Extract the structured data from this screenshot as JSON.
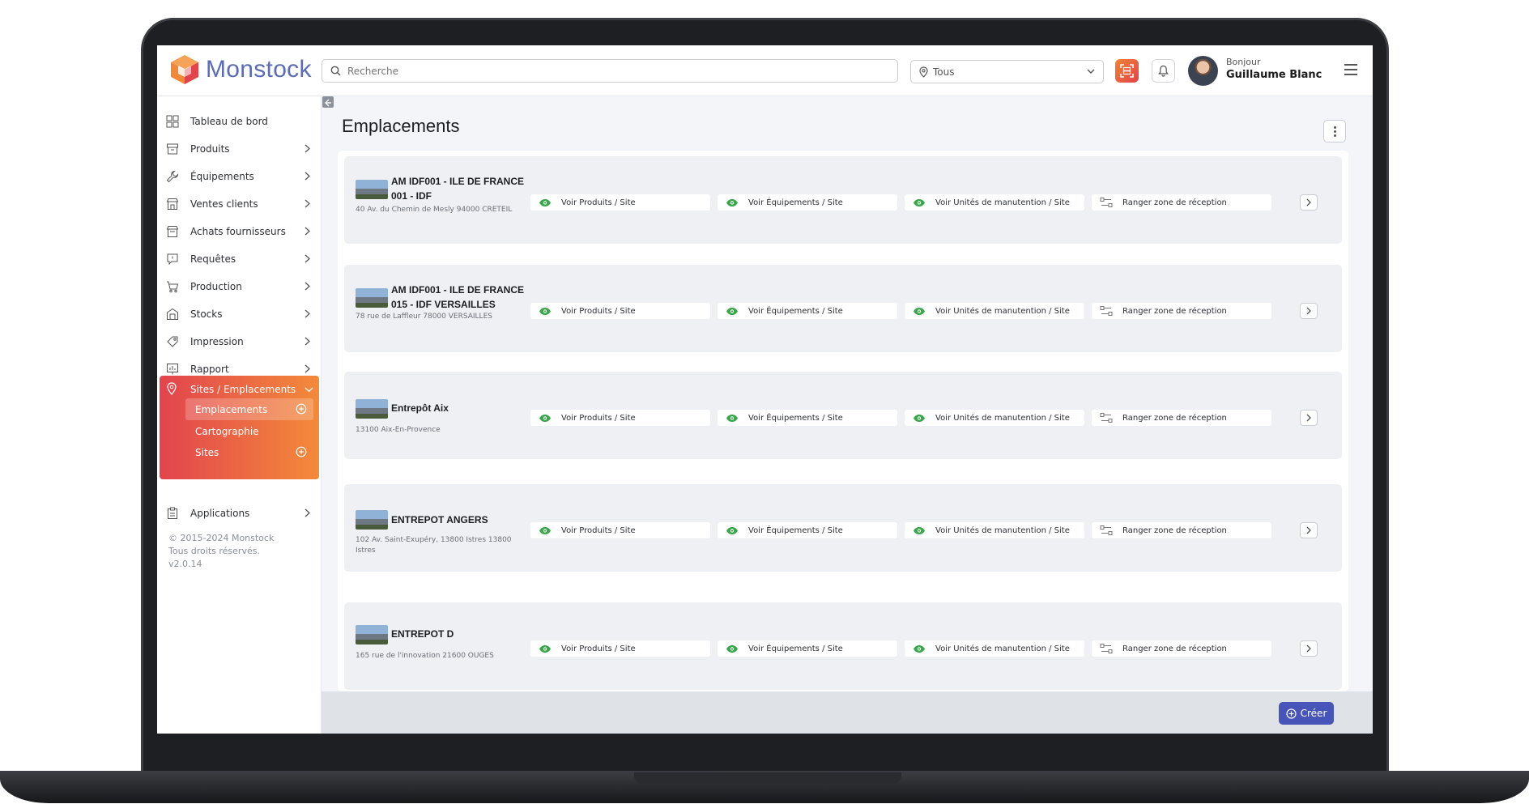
{
  "brand": {
    "name": "Monstock",
    "accent": "#5b6bb5",
    "gradient_start": "#e2444e",
    "gradient_end": "#f38a3a"
  },
  "topbar": {
    "search_placeholder": "Recherche",
    "site_filter": "Tous",
    "greeting": "Bonjour",
    "user_name": "Guillaume Blanc"
  },
  "sidebar": {
    "items": [
      {
        "label": "Tableau de bord",
        "icon": "dashboard-icon",
        "has_arrow": false
      },
      {
        "label": "Produits",
        "icon": "box-icon",
        "has_arrow": true
      },
      {
        "label": "Équipements",
        "icon": "wrench-icon",
        "has_arrow": true
      },
      {
        "label": "Ventes clients",
        "icon": "shop-icon",
        "has_arrow": true
      },
      {
        "label": "Achats fournisseurs",
        "icon": "store-icon",
        "has_arrow": true
      },
      {
        "label": "Requêtes",
        "icon": "message-icon",
        "has_arrow": true
      },
      {
        "label": "Production",
        "icon": "cart-icon",
        "has_arrow": true
      },
      {
        "label": "Stocks",
        "icon": "warehouse-icon",
        "has_arrow": true
      },
      {
        "label": "Impression",
        "icon": "tag-icon",
        "has_arrow": true
      },
      {
        "label": "Rapport",
        "icon": "report-icon",
        "has_arrow": true
      }
    ],
    "active_group": {
      "label": "Sites / Emplacements",
      "icon": "location-pin-icon",
      "children": [
        {
          "label": "Emplacements",
          "selected": true,
          "has_plus": true
        },
        {
          "label": "Cartographie",
          "selected": false,
          "has_plus": false
        },
        {
          "label": "Sites",
          "selected": false,
          "has_plus": true
        }
      ]
    },
    "after_items": [
      {
        "label": "Applications",
        "icon": "clipboard-icon",
        "has_arrow": true
      }
    ],
    "copyright_lines": [
      "© 2015-2024 Monstock",
      "Tous droits réservés.",
      "v2.0.14"
    ]
  },
  "main": {
    "title": "Emplacements",
    "actions": {
      "view_products": "Voir Produits / Site",
      "view_equipment": "Voir Équipements / Site",
      "view_units": "Voir Unités de manutention / Site",
      "store_reception": "Ranger zone de réception"
    },
    "locations": [
      {
        "name": "AM IDF001 - ILE DE FRANCE 001 - IDF",
        "address": "40 Av. du Chemin de Mesly 94000 CRETEIL"
      },
      {
        "name": "AM IDF001 - ILE DE FRANCE 015 - IDF VERSAILLES",
        "address": "78 rue de Laffleur 78000 VERSAILLES"
      },
      {
        "name": "Entrepôt Aix",
        "address": "13100 Aix-En-Provence"
      },
      {
        "name": "ENTREPOT ANGERS",
        "address": "102 Av. Saint-Exupéry, 13800 Istres 13800 Istres"
      },
      {
        "name": "ENTREPOT D",
        "address": "165 rue de l'innovation 21600 OUGES"
      }
    ],
    "create_label": "Créer"
  }
}
